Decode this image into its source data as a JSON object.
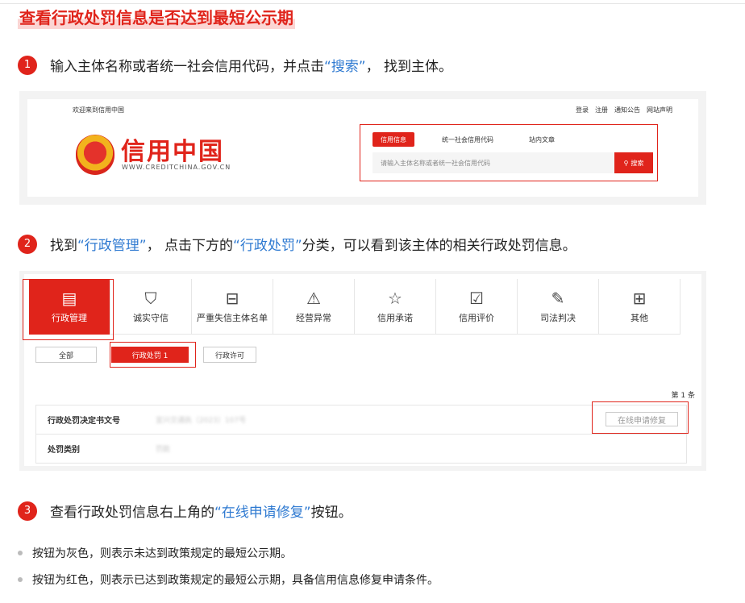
{
  "title": "查看行政处罚信息是否达到最短公示期",
  "steps": [
    {
      "num": "1",
      "before": "输入主体名称或者统一社会信用代码，并点击",
      "highlight": "“搜索”",
      "after": "， 找到主体。"
    },
    {
      "num": "2",
      "before": "找到",
      "highlight": "“行政管理”",
      "middle": "， 点击下方的",
      "highlight2": "“行政处罚”",
      "after": "分类，可以看到该主体的相关行政处罚信息。"
    },
    {
      "num": "3",
      "before": "查看行政处罚信息右上角的",
      "highlight": "“在线申请修复”",
      "after": "按钮。"
    }
  ],
  "screenshot1": {
    "welcome": "欢迎来到信用中国",
    "top_links": [
      "登录",
      "注册",
      "通知公告",
      "网站声明"
    ],
    "brand": "信用中国",
    "brand_url": "WWW.CREDITCHINA.GOV.CN",
    "search_tabs": [
      "信用信息",
      "统一社会信用代码",
      "站内文章"
    ],
    "search_placeholder": "请输入主体名称或者统一社会信用代码",
    "search_button": "搜索"
  },
  "screenshot2": {
    "categories": [
      {
        "label": "行政管理",
        "icon": "document-stamp-icon"
      },
      {
        "label": "诚实守信",
        "icon": "shield-check-icon"
      },
      {
        "label": "严重失信主体名单",
        "icon": "blacklist-icon"
      },
      {
        "label": "经营异常",
        "icon": "alarm-light-icon"
      },
      {
        "label": "信用承诺",
        "icon": "commitment-icon"
      },
      {
        "label": "信用评价",
        "icon": "evaluation-icon"
      },
      {
        "label": "司法判决",
        "icon": "judgment-icon"
      },
      {
        "label": "其他",
        "icon": "other-icon"
      }
    ],
    "filters": [
      "全部",
      "行政处罚  1",
      "行政许可"
    ],
    "count": "第 1 条",
    "rows": [
      {
        "key": "行政处罚决定书文号",
        "value": "宜兴交通执〔2023〕107号"
      },
      {
        "key": "处罚类别",
        "value": "罚款"
      }
    ],
    "repair_button": "在线申请修复"
  },
  "bullets": [
    "按钮为灰色，则表示未达到政策规定的最短公示期。",
    "按钮为红色，则表示已达到政策规定的最短公示期，具备信用信息修复申请条件。"
  ]
}
